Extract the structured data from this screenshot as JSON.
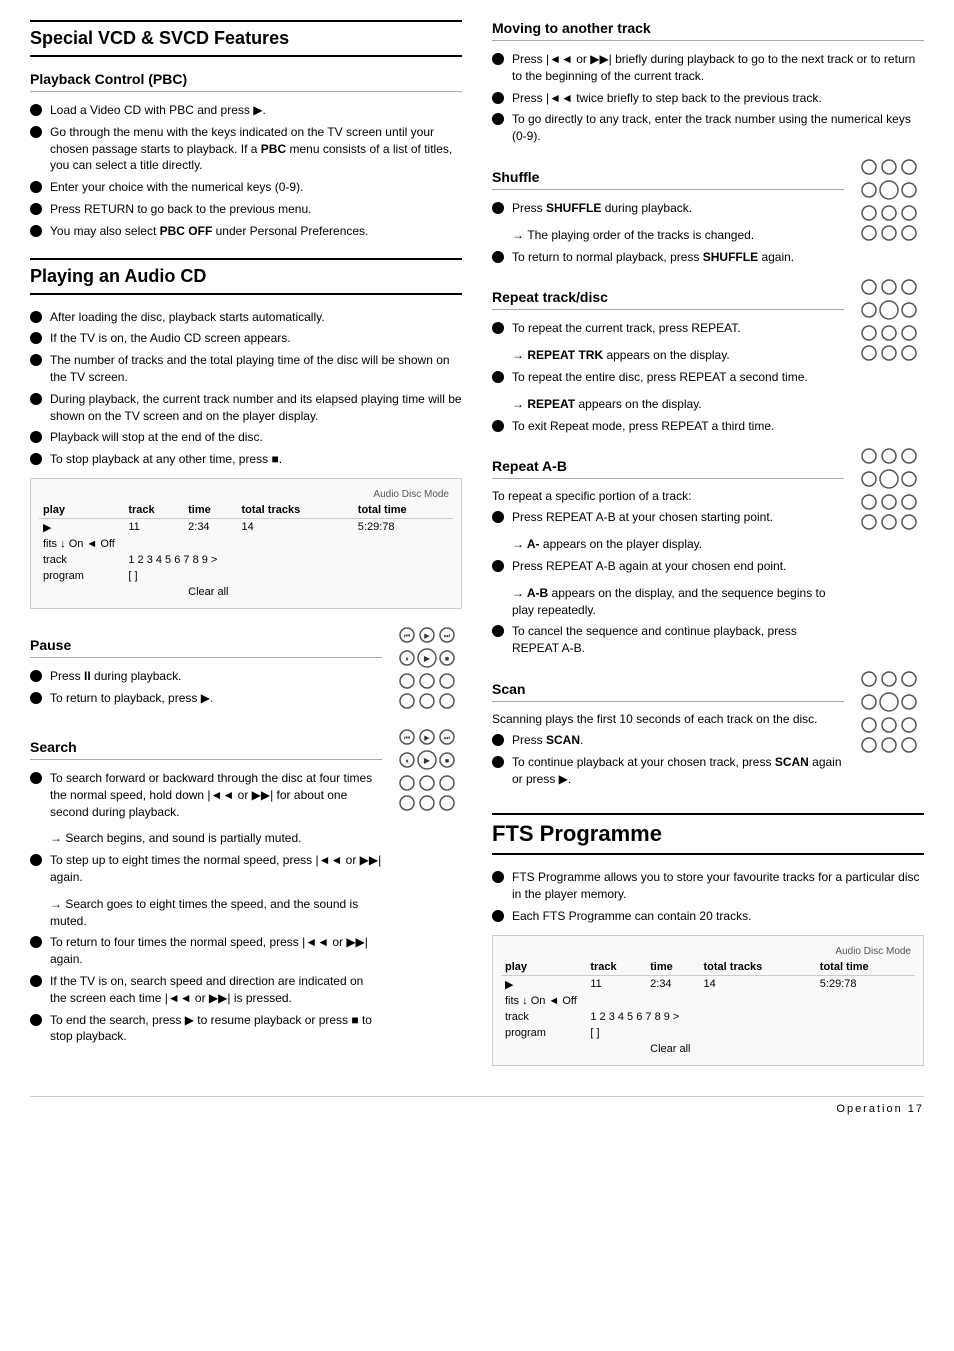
{
  "page": {
    "footer": "Operation  17"
  },
  "left": {
    "section1_title": "Special VCD & SVCD Features",
    "pbc_title": "Playback Control (PBC)",
    "pbc_items": [
      "Load a Video CD with PBC and press ▶.",
      "Go through the menu with the keys indicated on the TV screen until your chosen passage starts to playback. If a PBC menu consists of a list of titles, you can select a title directly.",
      "Enter your choice with the numerical keys (0-9).",
      "Press RETURN to go back to the previous menu.",
      "You may also select PBC OFF under Personal Preferences."
    ],
    "section2_title": "Playing an Audio CD",
    "audio_cd_items": [
      "After loading the disc, playback starts automatically.",
      "If the TV is on, the Audio CD screen appears.",
      "The number of tracks and the total playing time of the disc will be shown on the TV screen.",
      "During playback, the current track number and its elapsed playing time will be shown on the TV screen and on the player display.",
      "Playback will stop at the end of the disc.",
      "To stop playback at any other time, press ■."
    ],
    "display_table": {
      "mode": "Audio Disc Mode",
      "headers": [
        "play",
        "track",
        "time",
        "total tracks",
        "total time"
      ],
      "row1": [
        "▶",
        "11",
        "2:34",
        "14",
        "5:29:78"
      ],
      "row2_label": "fits ↓",
      "row2_val": "On ◄ Off",
      "row3_label": "track",
      "row3_val": "1  2  3  4  5  6  7  8  9  >",
      "row4_label": "program",
      "row4_val": "[ ]",
      "clear": "Clear all"
    },
    "pause_title": "Pause",
    "pause_items": [
      "Press II during playback.",
      "To return to playback, press ▶."
    ],
    "search_title": "Search",
    "search_items": [
      "To search forward or backward through the disc at four times the normal speed, hold down |◄◄ or ▶▶| for about one second during playback.",
      "→ Search begins, and sound is partially muted.",
      "To step up to eight times the normal speed, press |◄◄ or ▶▶| again.",
      "→ Search goes to eight times the speed, and the sound is muted.",
      "To return to four times the normal speed, press |◄◄ or ▶▶| again.",
      "If the TV is on, search speed and direction are indicated on the screen each time |◄◄ or ▶▶| is pressed.",
      "To end the search, press ▶ to resume playback or press ■ to stop playback."
    ],
    "press_during_playback": "Press during playback",
    "to_search_forward": "To search forward or backward through"
  },
  "right": {
    "moving_title": "Moving to another track",
    "moving_items": [
      "Press |◄◄ or ▶▶| briefly during playback to go to the next track or to return to the beginning of the current track.",
      "Press |◄◄ twice briefly to step back to the previous track.",
      "To go directly to any track, enter the track number using the numerical keys (0-9)."
    ],
    "shuffle_title": "Shuffle",
    "shuffle_items": [
      "Press SHUFFLE during playback.",
      "→ The playing order of the tracks is changed.",
      "To return to normal playback, press SHUFFLE again."
    ],
    "repeat_title": "Repeat track/disc",
    "repeat_items": [
      "To repeat the current track, press REPEAT.",
      "→ REPEAT TRK appears on the display.",
      "To repeat the entire disc, press REPEAT a second time.",
      "→ REPEAT appears on the display.",
      "To exit Repeat mode, press REPEAT a third time."
    ],
    "repeat_ab_title": "Repeat A-B",
    "repeat_ab_intro": "To repeat a specific portion of a track:",
    "repeat_ab_items": [
      "Press REPEAT A-B at your chosen starting point.",
      "→ A- appears on the player display.",
      "Press REPEAT A-B again at your chosen end point.",
      "→ A-B appears on the display, and the sequence begins to play repeatedly.",
      "To cancel the sequence and continue playback, press REPEAT A-B."
    ],
    "scan_title": "Scan",
    "scan_intro": "Scanning plays the first 10 seconds of each track on the disc.",
    "scan_items": [
      "Press SCAN.",
      "To continue playback at your chosen track, press SCAN again or press ▶."
    ],
    "fts_title": "FTS Programme",
    "fts_items": [
      "FTS Programme allows you to store your favourite tracks for a particular disc in the player memory.",
      "Each FTS Programme can contain 20 tracks."
    ],
    "fts_display": {
      "mode": "Audio Disc Mode",
      "headers": [
        "play",
        "track",
        "time",
        "total tracks",
        "total time"
      ],
      "row1": [
        "▶",
        "11",
        "2:34",
        "14",
        "5:29:78"
      ],
      "row2_label": "fits ↓",
      "row2_val": "On ◄ Off",
      "row3_label": "track",
      "row3_val": "1  2  3  4  5  6  7  8  9  >",
      "row4_label": "program",
      "row4_val": "[ ]",
      "clear": "Clear all"
    }
  }
}
